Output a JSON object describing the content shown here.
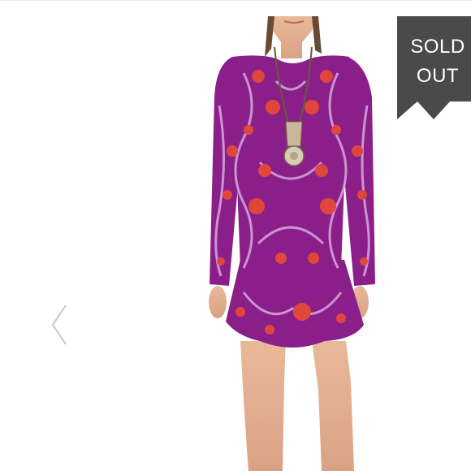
{
  "listing": {
    "badge": {
      "line1": "SOLD",
      "line2": "OUT",
      "color": "#4a4a4a"
    },
    "photo": {
      "icon": "dress-photo",
      "dress_color": "#8b1f8a",
      "print_color": "#e0463c"
    },
    "carousel": {
      "prev_icon": "chevron-left-icon"
    }
  }
}
